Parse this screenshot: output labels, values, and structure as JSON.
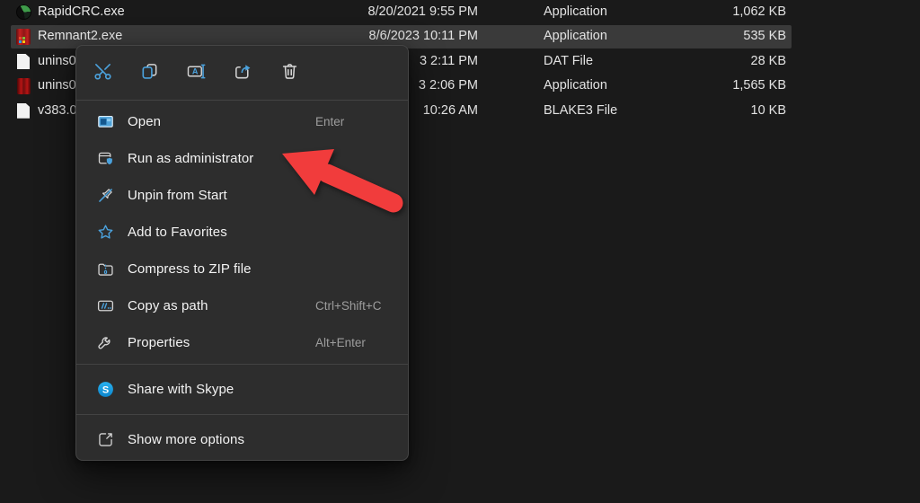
{
  "colors": {
    "accent_blue": "#4ba2dd",
    "icon_gray": "#d4d4d4",
    "arrow_red": "#f13c3c",
    "selection_bg": "#3a3a3a",
    "menu_bg": "#2d2d2d"
  },
  "file_list": {
    "rows": [
      {
        "name": "RapidCRC.exe",
        "date": "8/20/2021 9:55 PM",
        "type": "Application",
        "size": "1,062 KB",
        "icon": "rapidcrc-app-icon",
        "selected": false
      },
      {
        "name": "Remnant2.exe",
        "date": "8/6/2023 10:11 PM",
        "type": "Application",
        "size": "535 KB",
        "icon": "remnant2-app-icon",
        "selected": true
      },
      {
        "name": "unins0",
        "date": "3 2:11 PM",
        "type": "DAT File",
        "size": "28 KB",
        "icon": "document-icon",
        "selected": false
      },
      {
        "name": "unins0",
        "date": "3 2:06 PM",
        "type": "Application",
        "size": "1,565 KB",
        "icon": "installer-app-icon",
        "selected": false
      },
      {
        "name": "v383.0",
        "date": "10:26 AM",
        "type": "BLAKE3 File",
        "size": "10 KB",
        "icon": "document-icon",
        "selected": false
      }
    ]
  },
  "context_menu": {
    "toolbar": [
      {
        "action": "cut",
        "icon": "cut-icon"
      },
      {
        "action": "copy",
        "icon": "copy-icon"
      },
      {
        "action": "rename",
        "icon": "rename-icon"
      },
      {
        "action": "share",
        "icon": "share-icon"
      },
      {
        "action": "delete",
        "icon": "trash-icon"
      }
    ],
    "sections": [
      {
        "name": "main",
        "items": [
          {
            "label": "Open",
            "shortcut": "Enter",
            "icon": "open-icon"
          },
          {
            "label": "Run as administrator",
            "shortcut": "",
            "icon": "run-as-admin-icon"
          },
          {
            "label": "Unpin from Start",
            "shortcut": "",
            "icon": "unpin-icon"
          },
          {
            "label": "Add to Favorites",
            "shortcut": "",
            "icon": "favorites-star-icon"
          },
          {
            "label": "Compress to ZIP file",
            "shortcut": "",
            "icon": "zip-folder-icon"
          },
          {
            "label": "Copy as path",
            "shortcut": "Ctrl+Shift+C",
            "icon": "copy-path-icon"
          },
          {
            "label": "Properties",
            "shortcut": "Alt+Enter",
            "icon": "properties-wrench-icon"
          }
        ]
      },
      {
        "name": "share",
        "items": [
          {
            "label": "Share with Skype",
            "shortcut": "",
            "icon": "skype-icon"
          }
        ]
      },
      {
        "name": "footer",
        "items": [
          {
            "label": "Show more options",
            "shortcut": "",
            "icon": "show-more-options-icon"
          }
        ]
      }
    ]
  },
  "annotation": {
    "arrow_points_to": "Run as administrator"
  }
}
